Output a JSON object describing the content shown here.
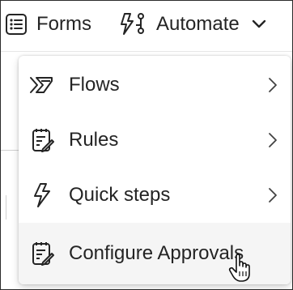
{
  "toolbar": {
    "forms_label": "Forms",
    "forms_icon": "forms-list-icon",
    "automate_label": "Automate",
    "automate_icon": "flow-lightning-icon",
    "automate_chevron": "chevron-down-icon"
  },
  "menu": {
    "items": [
      {
        "label": "Flows",
        "icon": "flows-icon",
        "has_submenu": true
      },
      {
        "label": "Rules",
        "icon": "rules-clipboard-icon",
        "has_submenu": true
      },
      {
        "label": "Quick steps",
        "icon": "lightning-icon",
        "has_submenu": true
      },
      {
        "label": "Configure Approvals",
        "icon": "approvals-clipboard-icon",
        "has_submenu": false,
        "hovered": true
      }
    ]
  },
  "colors": {
    "text": "#242424",
    "hover_bg": "#f5f5f5",
    "border": "#2b2b2b"
  }
}
